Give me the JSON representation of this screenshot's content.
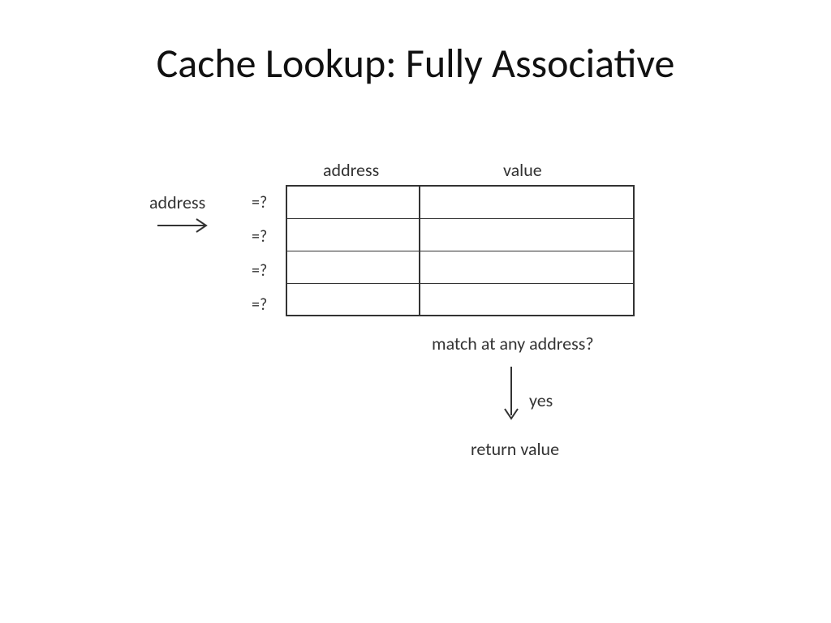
{
  "title": "Cache Lookup: Fully Associative",
  "columns": {
    "address": "address",
    "value": "value"
  },
  "input_label": "address",
  "compare_symbol": "=?",
  "rows": 4,
  "match_label": "match at any address?",
  "yes_label": "yes",
  "return_label": "return value"
}
